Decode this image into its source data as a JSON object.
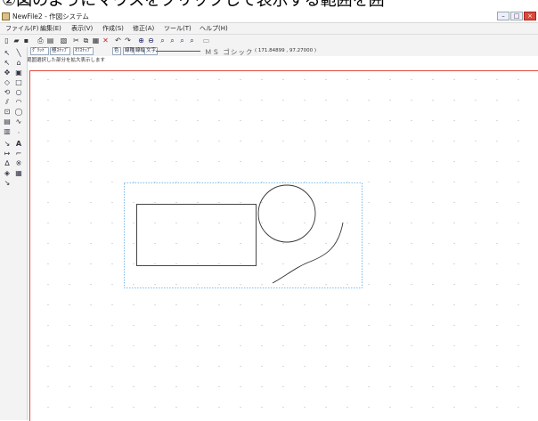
{
  "caption": "②図のようにマウスをクリックして表示する範囲を囲",
  "window": {
    "title": "NewFile2 - 作図システム"
  },
  "menu": [
    "ファイル(F)",
    "編集(E)",
    "表示(V)",
    "作成(S)",
    "修正(A)",
    "ツール(T)",
    "ヘルプ(H)"
  ],
  "toolbar2": {
    "btn1": "ｸﾞﾘｯﾄﾞ",
    "btn2": "極ｽﾅｯﾌﾟ",
    "btn3": "ｵﾌｽﾅｯﾌﾟ",
    "btn4": "色",
    "btn5": "線種",
    "btn6": "線幅",
    "btn7": "文字",
    "font_name": "ＭＳ ゴシック",
    "coordinates": "( 171.84899 , 97.27000 )"
  },
  "status_text": "範囲選択した部分を拡大表示します"
}
